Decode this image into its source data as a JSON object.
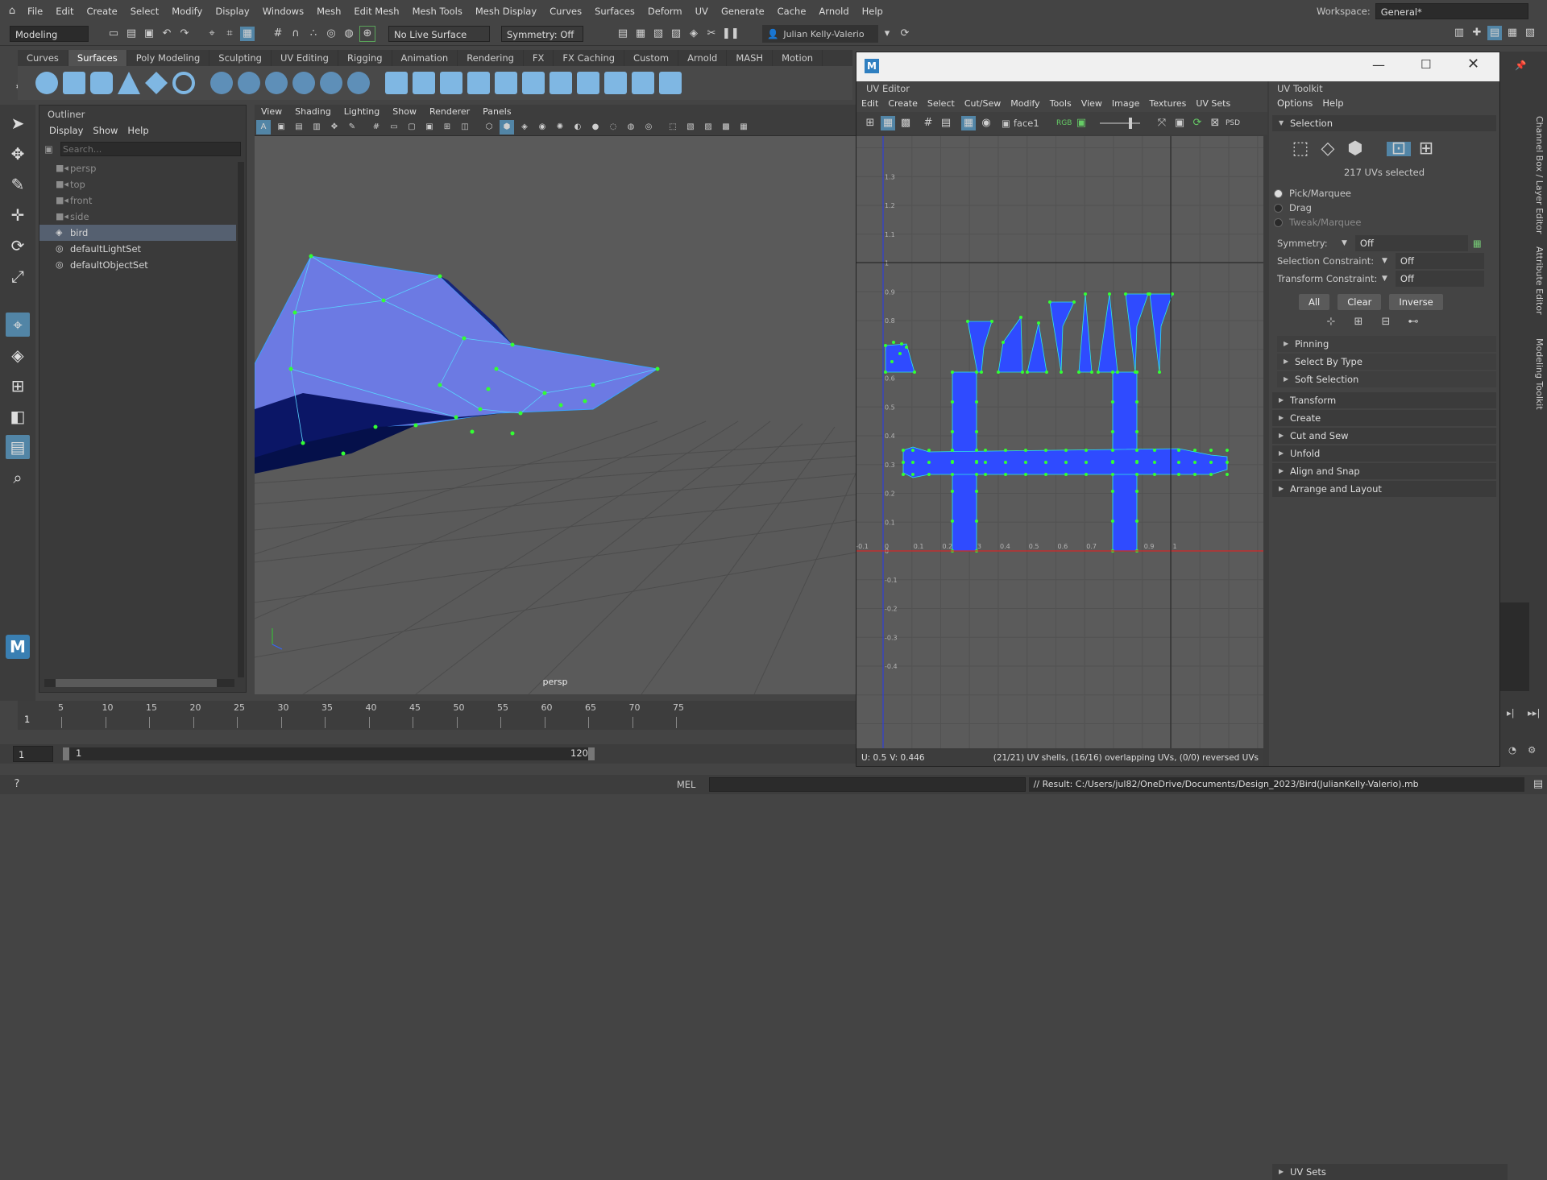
{
  "menubar": {
    "items": [
      "File",
      "Edit",
      "Create",
      "Select",
      "Modify",
      "Display",
      "Windows",
      "Mesh",
      "Edit Mesh",
      "Mesh Tools",
      "Mesh Display",
      "Curves",
      "Surfaces",
      "Deform",
      "UV",
      "Generate",
      "Cache",
      "Arnold",
      "Help"
    ],
    "workspace_label": "Workspace:",
    "workspace_value": "General*"
  },
  "statusline": {
    "mode": "Modeling",
    "live_surface": "No Live Surface",
    "symmetry": "Symmetry: Off",
    "user": "Julian Kelly-Valerio"
  },
  "shelf": {
    "tabs": [
      "Curves",
      "Surfaces",
      "Poly Modeling",
      "Sculpting",
      "UV Editing",
      "Rigging",
      "Animation",
      "Rendering",
      "FX",
      "FX Caching",
      "Custom",
      "Arnold",
      "MASH",
      "Motion"
    ],
    "active_tab": "Surfaces"
  },
  "outliner": {
    "title": "Outliner",
    "menus": [
      "Display",
      "Show",
      "Help"
    ],
    "search_placeholder": "Search...",
    "items": [
      {
        "label": "persp",
        "icon": "camera-icon",
        "dim": true
      },
      {
        "label": "top",
        "icon": "camera-icon",
        "dim": true
      },
      {
        "label": "front",
        "icon": "camera-icon",
        "dim": true
      },
      {
        "label": "side",
        "icon": "camera-icon",
        "dim": true
      },
      {
        "label": "bird",
        "icon": "mesh-icon",
        "dim": false,
        "selected": true
      },
      {
        "label": "defaultLightSet",
        "icon": "set-icon",
        "dim": false
      },
      {
        "label": "defaultObjectSet",
        "icon": "set-icon",
        "dim": false
      }
    ]
  },
  "viewport": {
    "menus": [
      "View",
      "Shading",
      "Lighting",
      "Show",
      "Renderer",
      "Panels"
    ],
    "camera_label": "persp"
  },
  "uv_editor": {
    "panel_title": "UV Editor",
    "menus": [
      "Edit",
      "Create",
      "Select",
      "Cut/Sew",
      "Modify",
      "Tools",
      "View",
      "Image",
      "Textures",
      "UV Sets"
    ],
    "face_field": "face1",
    "status_u": "U:  0.5",
    "status_v": "V:  0.446",
    "status_info": "(21/21) UV shells, (16/16) overlapping UVs, (0/0) reversed UVs",
    "x_ticks": [
      "-0.1",
      "0",
      "0.1",
      "0.2",
      "0.3",
      "0.4",
      "0.5",
      "0.6",
      "0.7",
      "0.8",
      "0.9",
      "1"
    ],
    "y_ticks": [
      "1.3",
      "1.2",
      "1.1",
      "1",
      "0.9",
      "0.8",
      "0.7",
      "0.6",
      "0.5",
      "0.4",
      "0.3",
      "0.2",
      "0.1",
      "0",
      "-0.1",
      "-0.2",
      "-0.3",
      "-0.4"
    ]
  },
  "uv_toolkit": {
    "title": "UV Toolkit",
    "menus": [
      "Options",
      "Help"
    ],
    "selection_header": "Selection",
    "uvs_selected": "217 UVs selected",
    "modes": [
      "Pick/Marquee",
      "Drag",
      "Tweak/Marquee"
    ],
    "symmetry_label": "Symmetry:",
    "symmetry_value": "Off",
    "selection_constraint_label": "Selection Constraint:",
    "selection_constraint_value": "Off",
    "transform_constraint_label": "Transform Constraint:",
    "transform_constraint_value": "Off",
    "buttons": [
      "All",
      "Clear",
      "Inverse"
    ],
    "sub_sections": [
      "Pinning",
      "Select By Type",
      "Soft Selection"
    ],
    "sections": [
      "Transform",
      "Create",
      "Cut and Sew",
      "Unfold",
      "Align and Snap",
      "Arrange and Layout"
    ],
    "bottom_section": "UV Sets"
  },
  "timeslider": {
    "ticks": [
      "5",
      "10",
      "15",
      "20",
      "25",
      "30",
      "35",
      "40",
      "45",
      "50",
      "55",
      "60",
      "65",
      "70",
      "75"
    ],
    "current_frame": "1"
  },
  "rangeslider": {
    "start": "1",
    "inner_start": "1",
    "inner_end": "120"
  },
  "cmdline": {
    "lang": "MEL",
    "result": "// Result: C:/Users/jul82/OneDrive/Documents/Design_2023/Bird(JulianKelly-Valerio).mb"
  },
  "right_tabs": [
    "Channel Box / Layer Editor",
    "Attribute Editor",
    "Modeling Toolkit"
  ],
  "colors": {
    "accent": "#5285a6",
    "mesh": "#6f7de6",
    "uv_shell": "#2f4bff",
    "uv_point": "#33ff33"
  }
}
